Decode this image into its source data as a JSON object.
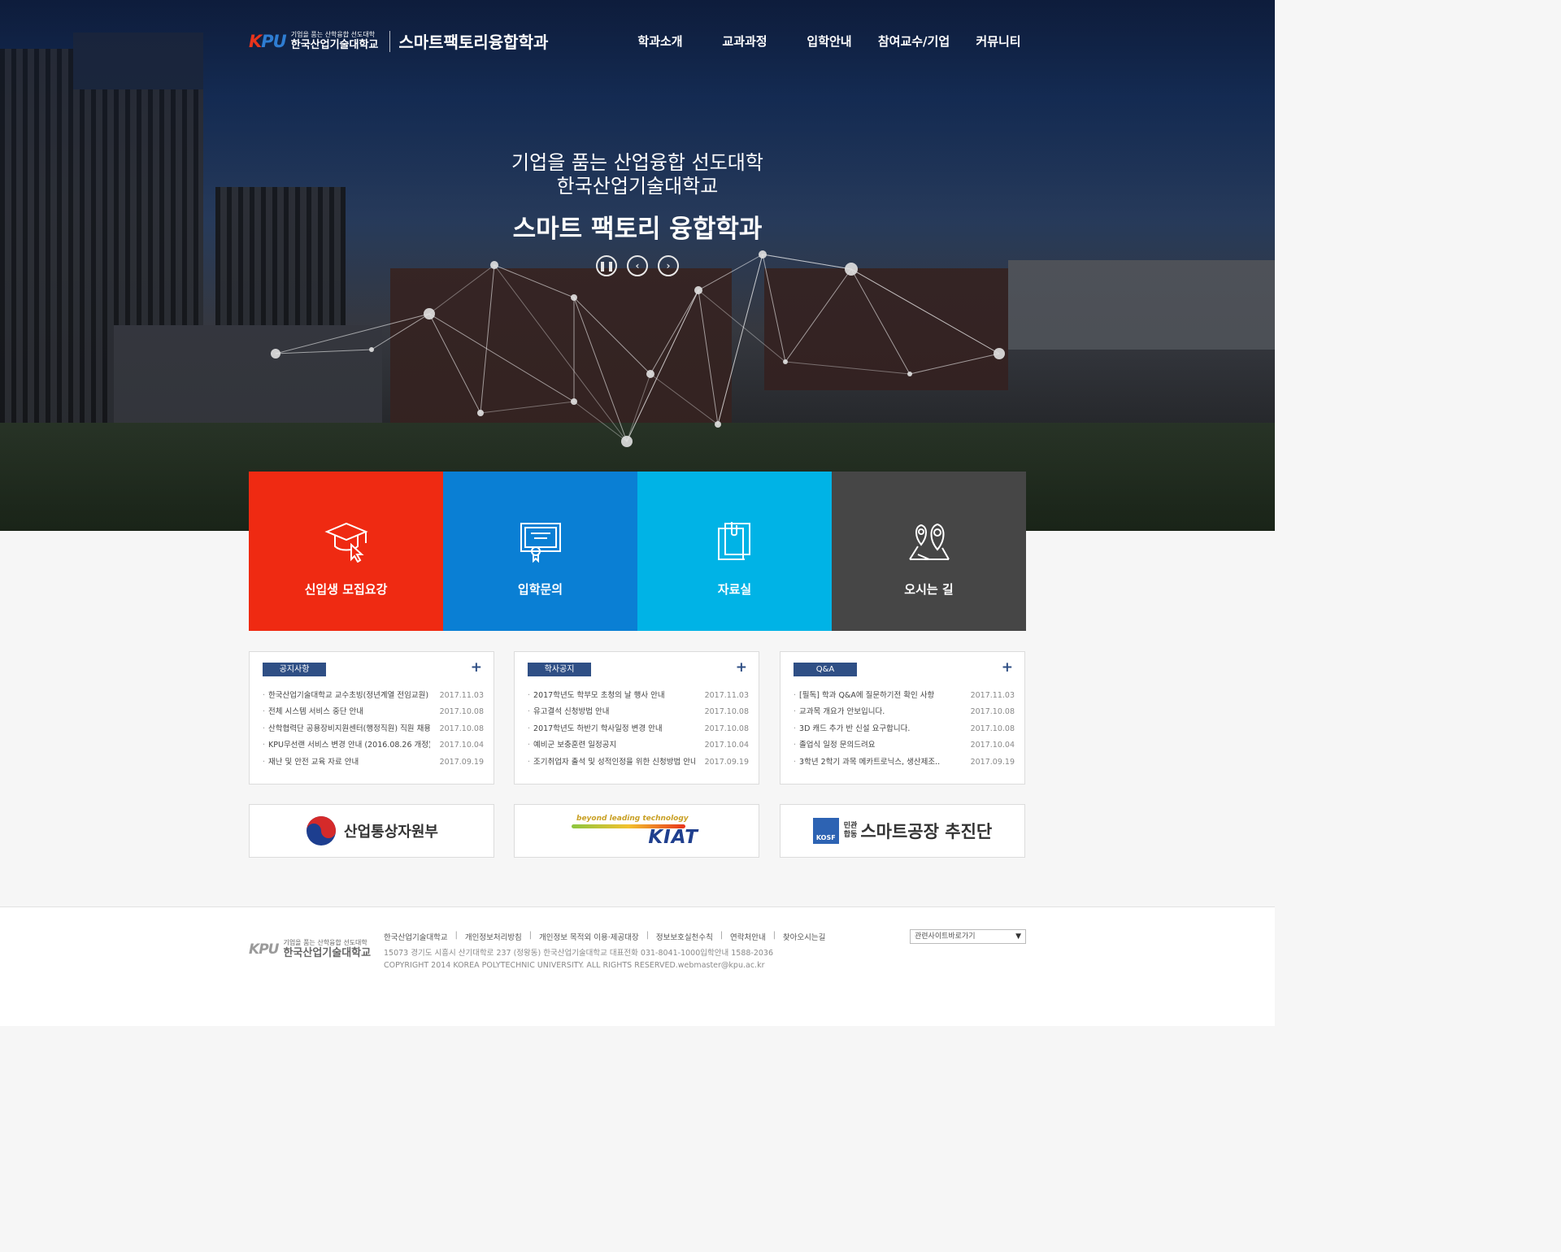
{
  "header": {
    "logo_mark_k": "K",
    "logo_mark_pu": "PU",
    "logo_slogan": "기업을 품는 산학융합 선도대학",
    "logo_university": "한국산업기술대학교",
    "department": "스마트팩토리융합학과",
    "nav": [
      "학과소개",
      "교과과정",
      "입학안내",
      "참여교수/기업",
      "커뮤니티"
    ]
  },
  "hero": {
    "line1": "기업을 품는 산업융합 선도대학",
    "line2": "한국산업기술대학교",
    "line3": "스마트 팩토리 융합학과",
    "controls": [
      "pause-icon",
      "chevron-left-icon",
      "chevron-right-icon"
    ]
  },
  "tiles": [
    {
      "label": "신입생 모집요강",
      "icon": "graduation-cap-icon",
      "color": "#ef2a12"
    },
    {
      "label": "입학문의",
      "icon": "certificate-icon",
      "color": "#0a7fd4"
    },
    {
      "label": "자료실",
      "icon": "documents-icon",
      "color": "#00b3e6"
    },
    {
      "label": "오시는 길",
      "icon": "map-pin-icon",
      "color": "#464646"
    }
  ],
  "boards": [
    {
      "title": "공지사항",
      "more_icon": "plus-icon",
      "items": [
        {
          "title": "한국산업기술대학교 교수초빙(정년계열 전임교원)",
          "date": "2017.11.03"
        },
        {
          "title": "전체 시스템 서비스 중단 안내",
          "date": "2017.10.08"
        },
        {
          "title": "산학협력단 공용장비지원센터(행정직원) 직원 채용",
          "date": "2017.10.08"
        },
        {
          "title": "KPU무선랜 서비스 변경 안내 (2016.08.26 개정)",
          "date": "2017.10.04"
        },
        {
          "title": "재난 및 안전 교육 자료 안내",
          "date": "2017.09.19"
        }
      ]
    },
    {
      "title": "학사공지",
      "more_icon": "plus-icon",
      "items": [
        {
          "title": "2017학년도 학부모 초청의 날 행사 안내",
          "date": "2017.11.03"
        },
        {
          "title": "유고결석 신청방법 안내",
          "date": "2017.10.08"
        },
        {
          "title": "2017학년도 하반기 학사일정 변경 안내",
          "date": "2017.10.08"
        },
        {
          "title": "예비군 보충훈련 일정공지",
          "date": "2017.10.04"
        },
        {
          "title": "조기취업자 출석 및 성적인정을 위한 신청방법 안내",
          "date": "2017.09.19"
        }
      ]
    },
    {
      "title": "Q&A",
      "more_icon": "plus-icon",
      "items": [
        {
          "title": "[필독] 학과 Q&A에 질문하기전 확인 사항",
          "date": "2017.11.03"
        },
        {
          "title": "교과목 개요가 안보입니다.",
          "date": "2017.10.08"
        },
        {
          "title": "3D 캐드 추가 반 신설 요구합니다.",
          "date": "2017.10.08"
        },
        {
          "title": "졸업식 일정 문의드려요",
          "date": "2017.10.04"
        },
        {
          "title": "3학년 2학기 과목 메카트로닉스, 생산제조..",
          "date": "2017.09.19"
        }
      ]
    }
  ],
  "partners": {
    "motie": "산업통상자원부",
    "kiat_tagline": "beyond leading technology",
    "kiat": "KIAT",
    "kosf_box": "KOSF",
    "kosf_small1": "민관",
    "kosf_small2": "합동",
    "kosf": "스마트공장 추진단"
  },
  "footer": {
    "links": [
      "한국산업기술대학교",
      "개인정보처리방침",
      "개인정보 목적외 이용·제공대장",
      "정보보호실천수칙",
      "연락처안내",
      "찾아오시는길"
    ],
    "address": "15073 경기도 시흥시 산기대학로 237 (정왕동) 한국산업기술대학교 대표전화 031-8041-1000입학안내 1588-2036",
    "copyright": "COPYRIGHT 2014 KOREA POLYTECHNIC UNIVERSITY. ALL RIGHTS RESERVED.webmaster@kpu.ac.kr",
    "select_label": "관련사이트바로가기"
  }
}
